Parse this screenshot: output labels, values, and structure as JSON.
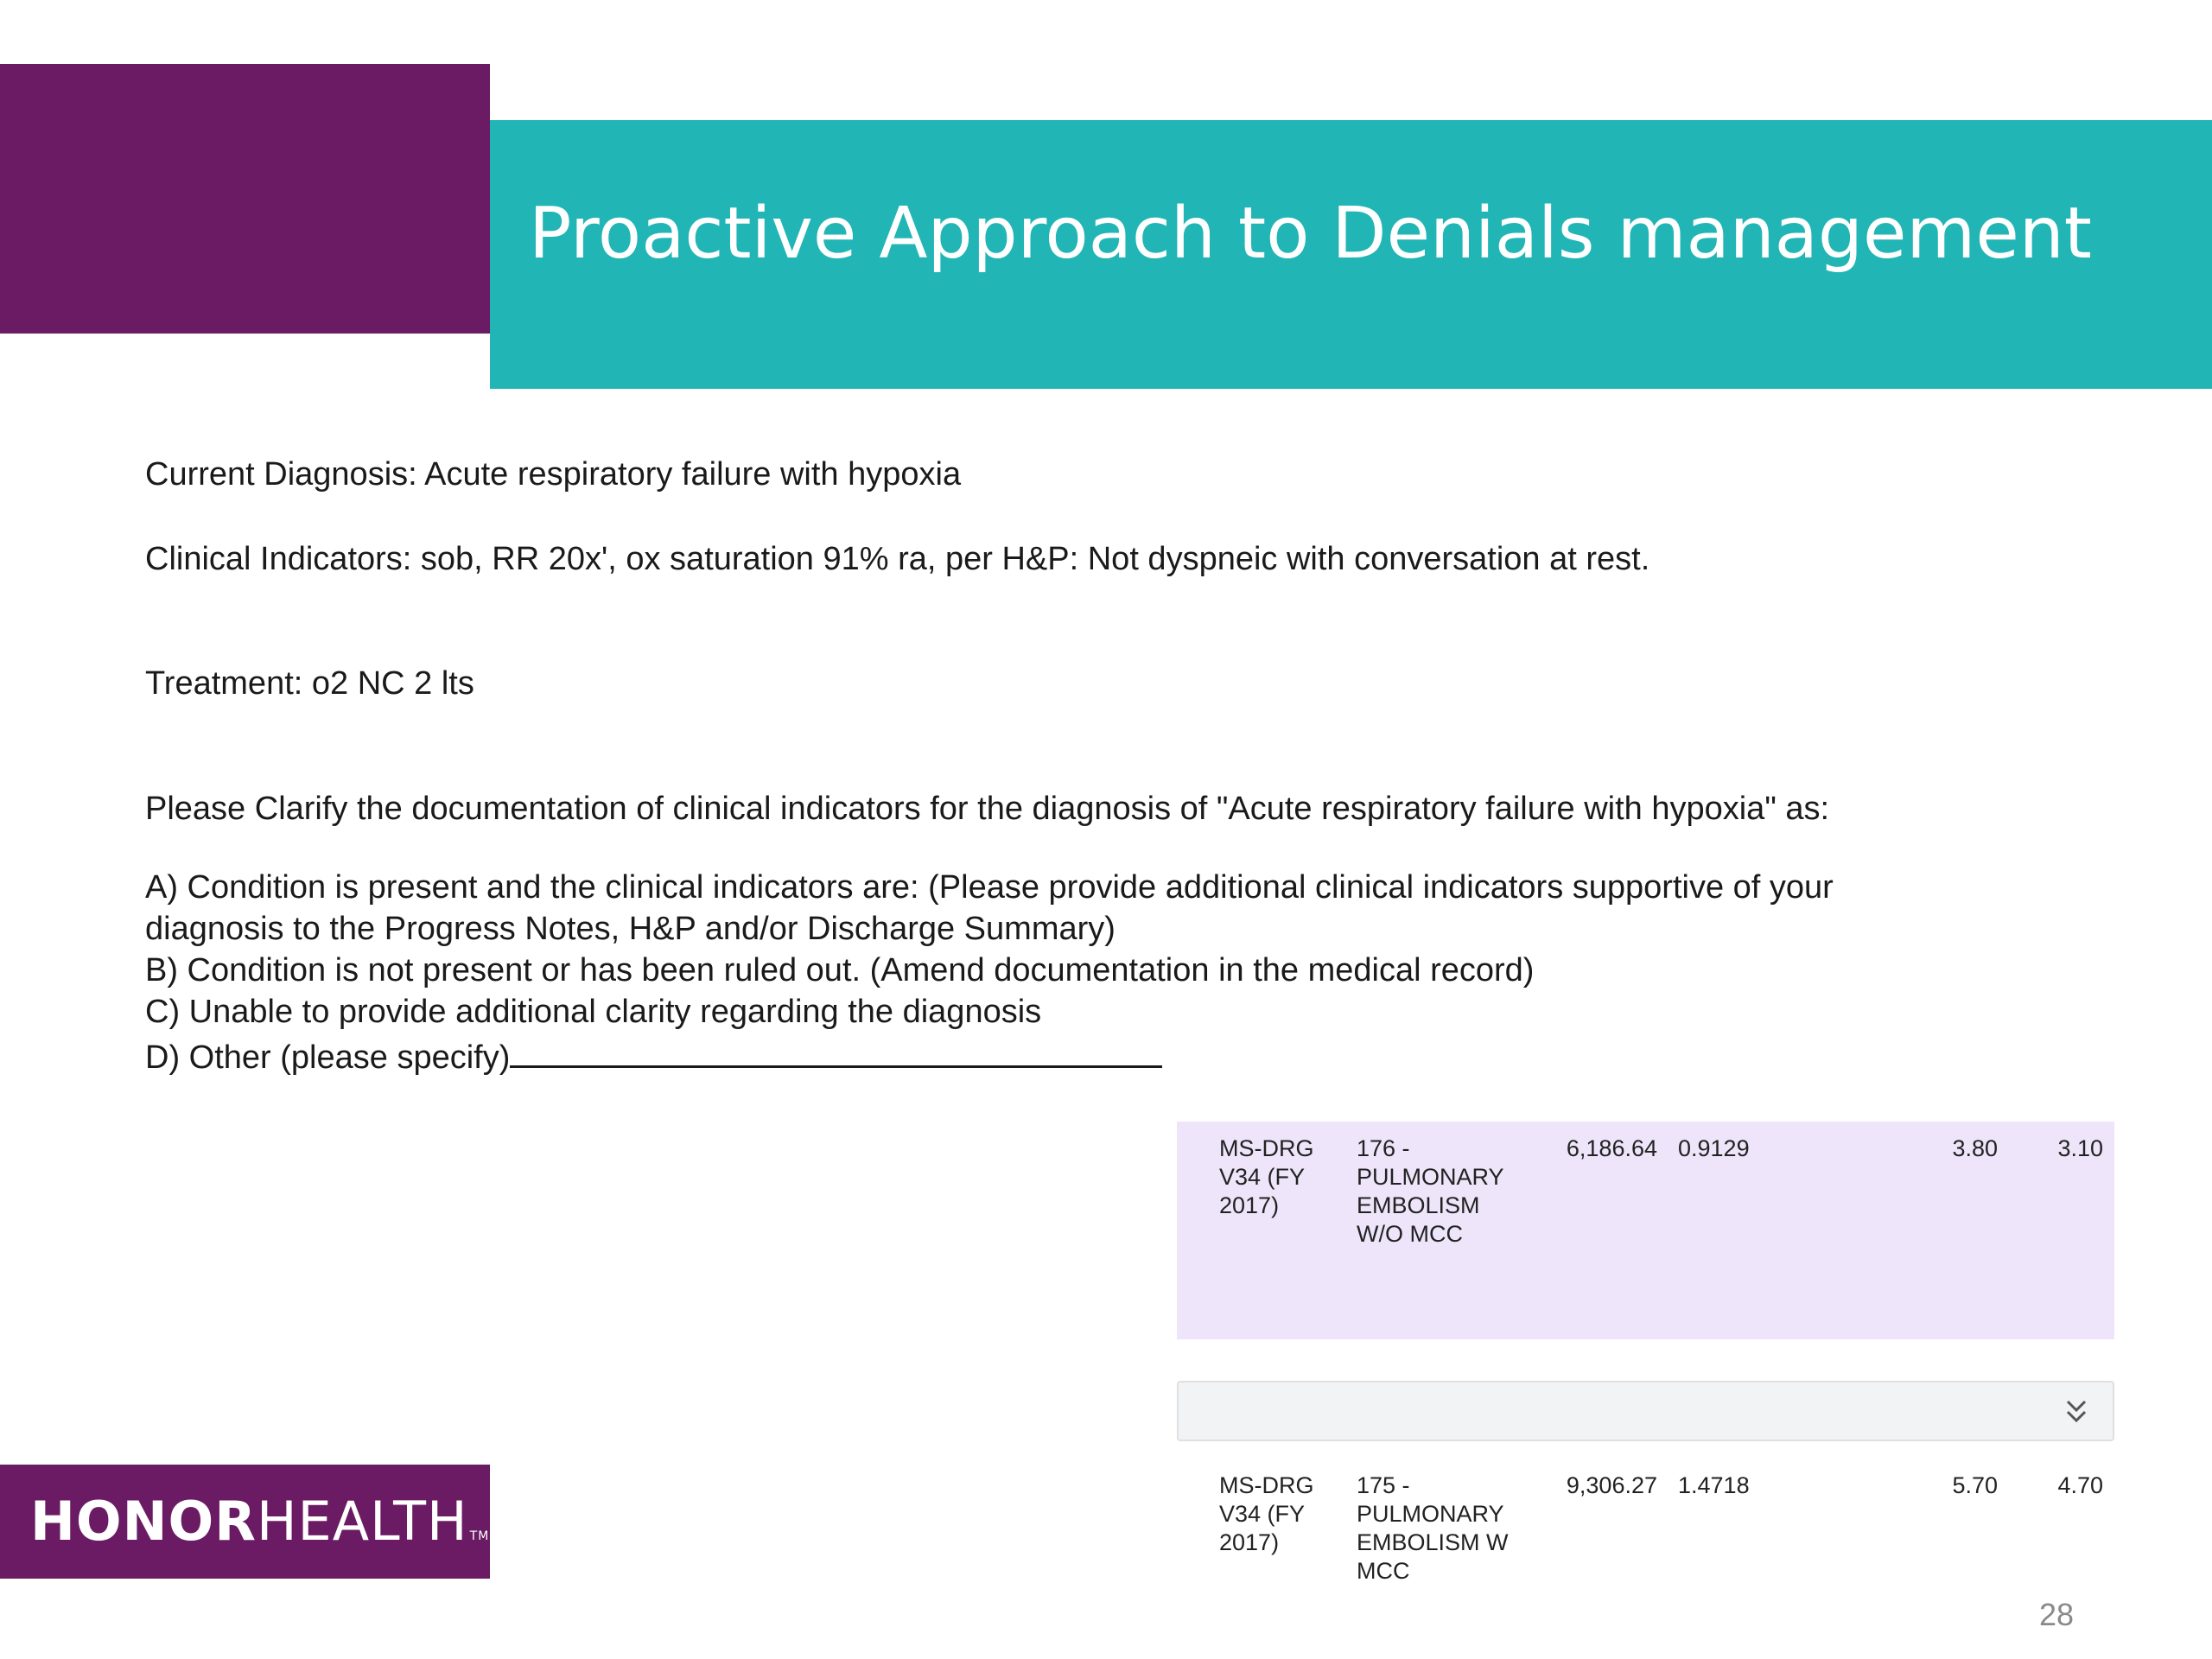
{
  "slide": {
    "title": "Proactive Approach to Denials management",
    "page_number": "28"
  },
  "query": {
    "current_diagnosis": "Current Diagnosis: Acute respiratory failure with hypoxia",
    "clinical_indicators": "Clinical Indicators: sob, RR 20x', ox saturation 91% ra, per H&P: Not dyspneic with conversation at rest.",
    "treatment": "Treatment: o2 NC 2 lts",
    "clarify_prompt": "Please Clarify the documentation of clinical indicators for the diagnosis of \"Acute respiratory failure with hypoxia\" as:",
    "option_a_line1": "A) Condition is present and the clinical indicators are: (Please provide additional clinical indicators supportive of your",
    "option_a_line2": "diagnosis to the Progress Notes, H&P and/or Discharge Summary)",
    "option_b": "B) Condition is not present or has been ruled out. (Amend documentation in the medical record)",
    "option_c": "C) Unable to provide additional clarity regarding the diagnosis",
    "option_d": "D) Other (please specify)"
  },
  "drg_rows": [
    {
      "version_l1": "MS-DRG",
      "version_l2": "V34 (FY",
      "version_l3": "2017)",
      "name_l1": "176 -",
      "name_l2": "PULMONARY",
      "name_l3": "EMBOLISM",
      "name_l4": "W/O MCC",
      "payment": "6,186.64",
      "relative_weight": "0.9129",
      "gmlos": "3.80",
      "amlos": "3.10"
    },
    {
      "version_l1": "MS-DRG",
      "version_l2": "V34 (FY",
      "version_l3": "2017)",
      "name_l1": "175 -",
      "name_l2": "PULMONARY",
      "name_l3": "EMBOLISM W",
      "name_l4": "MCC",
      "payment": "9,306.27",
      "relative_weight": "1.4718",
      "gmlos": "5.70",
      "amlos": "4.70"
    }
  ],
  "logo": {
    "bold_part": "HONOR",
    "light_part": "HEALTH",
    "trademark": "TM"
  },
  "colors": {
    "brand_purple": "#6a1b63",
    "brand_teal": "#22b5b5",
    "row_highlight": "#eee5fa"
  },
  "icons": {
    "collapse": "chevron-double-down-icon"
  }
}
